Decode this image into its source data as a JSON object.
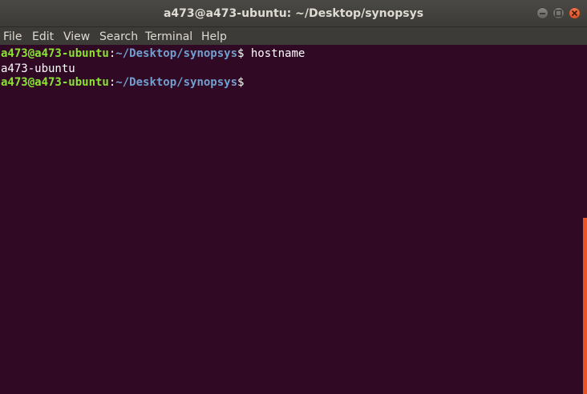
{
  "window": {
    "title": "a473@a473-ubuntu: ~/Desktop/synopsys",
    "controls": [
      "minimize-icon",
      "maximize-icon",
      "close-icon"
    ]
  },
  "menubar": {
    "items": [
      "File",
      "Edit",
      "View",
      "Search",
      "Terminal",
      "Help"
    ]
  },
  "terminal": {
    "lines": [
      {
        "user_host": "a473@a473-ubuntu",
        "colon": ":",
        "path": "~/Desktop/synopsys",
        "symbol": "$",
        "command": " hostname"
      },
      {
        "output": "a473-ubuntu"
      },
      {
        "user_host": "a473@a473-ubuntu",
        "colon": ":",
        "path": "~/Desktop/synopsys",
        "symbol": "$",
        "command": ""
      }
    ]
  },
  "colors": {
    "background": "#300a24",
    "prompt_user": "#8ae234",
    "prompt_path": "#729fcf",
    "accent": "#e95420"
  }
}
